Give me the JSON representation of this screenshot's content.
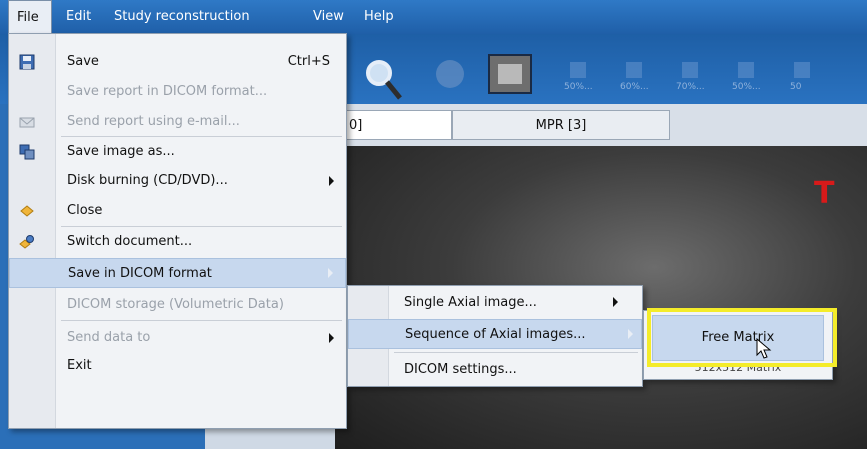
{
  "menubar": {
    "items": [
      {
        "label": "File"
      },
      {
        "label": "Edit"
      },
      {
        "label": "Study reconstruction"
      },
      {
        "label": "View"
      },
      {
        "label": "Help"
      }
    ]
  },
  "toolbar": {
    "preset_labels": [
      "50%...",
      "60%...",
      "70%...",
      "50%...",
      "50"
    ]
  },
  "tabs": [
    {
      "label": "0]"
    },
    {
      "label": "MPR [3]"
    }
  ],
  "viewport": {
    "orientation_marker": "T"
  },
  "file_menu": {
    "items": [
      {
        "label": "Save",
        "shortcut": "Ctrl+S",
        "icon": "save-icon",
        "disabled": false
      },
      {
        "label": "Save report in DICOM format...",
        "disabled": true
      },
      {
        "label": "Send report using e-mail...",
        "icon": "email-icon",
        "disabled": true
      },
      {
        "label": "Save image as...",
        "icon": "save-image-icon",
        "disabled": false
      },
      {
        "label": "Disk burning (CD/DVD)...",
        "submenu": true,
        "disabled": false
      },
      {
        "label": "Close",
        "icon": "close-document-icon",
        "disabled": false
      },
      {
        "label": "Switch document...",
        "icon": "switch-document-icon",
        "disabled": false
      },
      {
        "label": "Save in DICOM format",
        "submenu": true,
        "highlighted": true
      },
      {
        "label": "DICOM storage (Volumetric Data)",
        "disabled": true
      },
      {
        "label": "Send data to",
        "submenu": true,
        "disabled": true
      },
      {
        "label": "Exit",
        "disabled": false
      }
    ]
  },
  "dicom_submenu": {
    "items": [
      {
        "label": "Single Axial image...",
        "submenu": true
      },
      {
        "label": "Sequence of Axial images...",
        "submenu": true,
        "highlighted": true
      },
      {
        "label": "DICOM settings..."
      }
    ]
  },
  "sequence_submenu": {
    "items": [
      {
        "label": "Free Matrix",
        "highlighted": true
      },
      {
        "label": "512x512 Matrix"
      }
    ]
  },
  "colors": {
    "menubar": "#2f79c6",
    "highlight": "#c7d8ee",
    "annotation_box": "#f4ec2a",
    "orientation_marker": "#d81a1a"
  }
}
